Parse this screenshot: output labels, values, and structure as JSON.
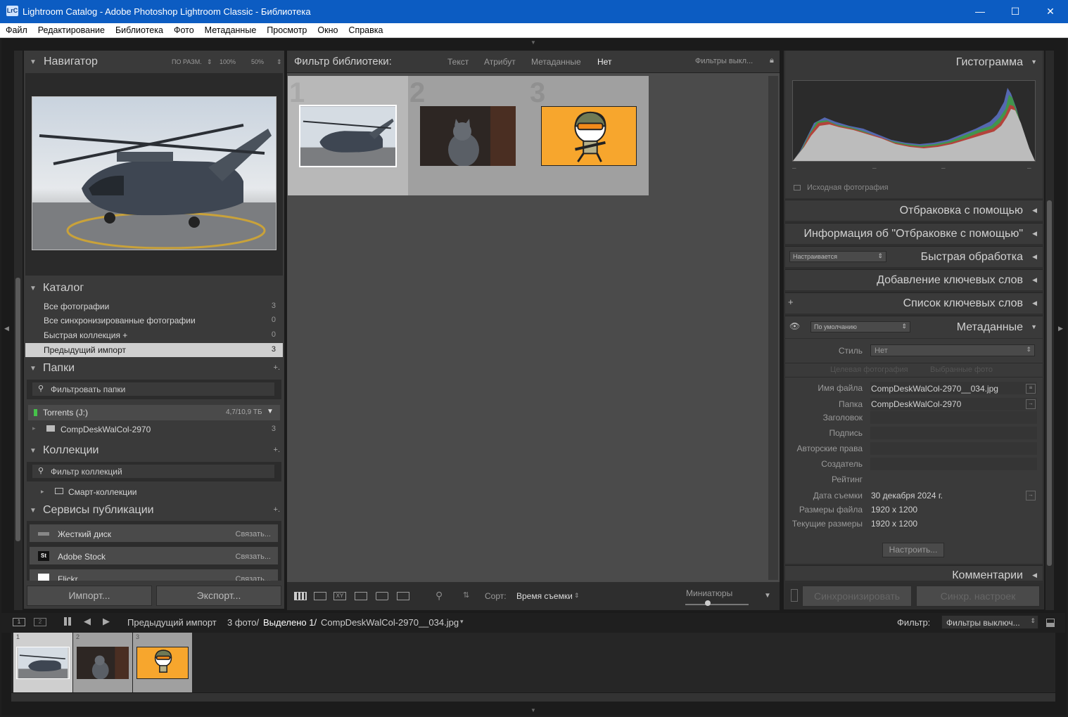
{
  "window": {
    "title": "Lightroom Catalog - Adobe Photoshop Lightroom Classic - Библиотека",
    "logo": "LrC",
    "minimize_icon": "—",
    "maximize_icon": "☐",
    "close_icon": "✕"
  },
  "menu": [
    "Файл",
    "Редактирование",
    "Библиотека",
    "Фото",
    "Метаданные",
    "Просмотр",
    "Окно",
    "Справка"
  ],
  "navigator": {
    "title": "Навигатор",
    "zoom_options": [
      "ПО РАЗМ.",
      "100%",
      "50%"
    ]
  },
  "catalog": {
    "title": "Каталог",
    "items": [
      {
        "label": "Все фотографии",
        "count": "3"
      },
      {
        "label": "Все синхронизированные фотографии",
        "count": "0"
      },
      {
        "label": "Быстрая коллекция  +",
        "count": "0"
      },
      {
        "label": "Предыдущий импорт",
        "count": "3"
      }
    ]
  },
  "folders": {
    "title": "Папки",
    "add": "+.",
    "filter_placeholder": "Фильтровать папки",
    "volume": "Torrents (J:)",
    "volume_size": "4,7/10,9 ТБ",
    "folder": "CompDeskWalCol-2970",
    "folder_count": "3"
  },
  "collections": {
    "title": "Коллекции",
    "add": "+.",
    "filter_placeholder": "Фильтр коллекций",
    "smart": "Смарт-коллекции"
  },
  "publish": {
    "title": "Сервисы публикации",
    "add": "+.",
    "services": [
      {
        "name": "Жесткий диск",
        "action": "Связать..."
      },
      {
        "name": "Adobe Stock",
        "action": "Связать..."
      },
      {
        "name": "Flickr",
        "action": "Связать..."
      }
    ]
  },
  "left_buttons": {
    "import": "Импорт...",
    "export": "Экспорт..."
  },
  "filter_bar": {
    "label": "Фильтр библиотеки:",
    "options": [
      "Текст",
      "Атрибут",
      "Метаданные",
      "Нет"
    ],
    "active": "Нет",
    "right": "Фильтры выкл..."
  },
  "grid": {
    "cells": [
      {
        "index": "1",
        "subject": "helicopter"
      },
      {
        "index": "2",
        "subject": "cat"
      },
      {
        "index": "3",
        "subject": "cartoon-soldier"
      }
    ]
  },
  "toolbar": {
    "sort_label": "Сорт:",
    "sort_value": "Время съемки",
    "thumbs_label": "Миниатюры"
  },
  "histogram": {
    "title": "Гистограмма",
    "original_photo": "Исходная фотография"
  },
  "right_panels": {
    "culling": "Отбраковка с помощью",
    "culling_info": "Информация об \"Отбраковке с помощью\"",
    "quick_develop": "Быстрая обработка",
    "quick_develop_preset": "Настраивается",
    "keywording": "Добавление ключевых слов",
    "keyword_list": "Список ключевых слов",
    "metadata": "Метаданные",
    "metadata_preset": "По умолчанию",
    "comments": "Комментарии"
  },
  "metadata": {
    "style_label": "Стиль",
    "style_value": "Нет",
    "tab_target": "Целевая фотография",
    "tab_selected": "Выбранные фото",
    "fields": [
      {
        "label": "Имя файла",
        "value": "CompDeskWalCol-2970__034.jpg"
      },
      {
        "label": "Папка",
        "value": "CompDeskWalCol-2970"
      },
      {
        "label": "Заголовок",
        "value": ""
      },
      {
        "label": "Подпись",
        "value": ""
      },
      {
        "label": "Авторские права",
        "value": ""
      },
      {
        "label": "Создатель",
        "value": ""
      },
      {
        "label": "Рейтинг",
        "value": ""
      },
      {
        "label": "Дата съемки",
        "value": "30 декабря 2024 г."
      },
      {
        "label": "Размеры файла",
        "value": "1920 x 1200"
      },
      {
        "label": "Текущие размеры",
        "value": "1920 x 1200"
      }
    ],
    "customize": "Настроить..."
  },
  "right_buttons": {
    "sync": "Синхронизировать",
    "sync_settings": "Синхр. настроек"
  },
  "bottom_bar": {
    "screen1": "1",
    "screen2": "2",
    "source": "Предыдущий импорт",
    "photo_count": "3 фото/",
    "selected": "Выделено 1/",
    "filename": "CompDeskWalCol-2970__034.jpg",
    "filter_label": "Фильтр:",
    "filter_value": "Фильтры выключ..."
  },
  "filmstrip": {
    "cells": [
      "1",
      "2",
      "3"
    ]
  },
  "colors": {
    "title_bar": "#0c5cc2",
    "panel": "#3a3a3a",
    "grid_bg": "#4b4b4b",
    "thumb3_bg": "#f7a62d"
  }
}
